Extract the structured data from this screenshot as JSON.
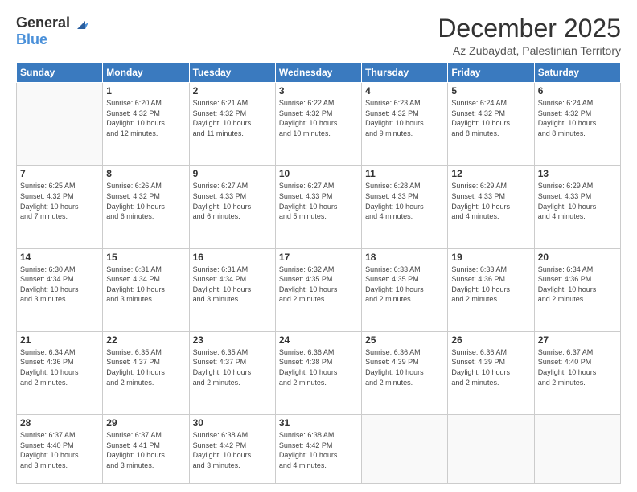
{
  "logo": {
    "general": "General",
    "blue": "Blue"
  },
  "header": {
    "month_year": "December 2025",
    "location": "Az Zubaydat, Palestinian Territory"
  },
  "weekdays": [
    "Sunday",
    "Monday",
    "Tuesday",
    "Wednesday",
    "Thursday",
    "Friday",
    "Saturday"
  ],
  "weeks": [
    [
      {
        "day": "",
        "info": ""
      },
      {
        "day": "1",
        "info": "Sunrise: 6:20 AM\nSunset: 4:32 PM\nDaylight: 10 hours\nand 12 minutes."
      },
      {
        "day": "2",
        "info": "Sunrise: 6:21 AM\nSunset: 4:32 PM\nDaylight: 10 hours\nand 11 minutes."
      },
      {
        "day": "3",
        "info": "Sunrise: 6:22 AM\nSunset: 4:32 PM\nDaylight: 10 hours\nand 10 minutes."
      },
      {
        "day": "4",
        "info": "Sunrise: 6:23 AM\nSunset: 4:32 PM\nDaylight: 10 hours\nand 9 minutes."
      },
      {
        "day": "5",
        "info": "Sunrise: 6:24 AM\nSunset: 4:32 PM\nDaylight: 10 hours\nand 8 minutes."
      },
      {
        "day": "6",
        "info": "Sunrise: 6:24 AM\nSunset: 4:32 PM\nDaylight: 10 hours\nand 8 minutes."
      }
    ],
    [
      {
        "day": "7",
        "info": "Sunrise: 6:25 AM\nSunset: 4:32 PM\nDaylight: 10 hours\nand 7 minutes."
      },
      {
        "day": "8",
        "info": "Sunrise: 6:26 AM\nSunset: 4:32 PM\nDaylight: 10 hours\nand 6 minutes."
      },
      {
        "day": "9",
        "info": "Sunrise: 6:27 AM\nSunset: 4:33 PM\nDaylight: 10 hours\nand 6 minutes."
      },
      {
        "day": "10",
        "info": "Sunrise: 6:27 AM\nSunset: 4:33 PM\nDaylight: 10 hours\nand 5 minutes."
      },
      {
        "day": "11",
        "info": "Sunrise: 6:28 AM\nSunset: 4:33 PM\nDaylight: 10 hours\nand 4 minutes."
      },
      {
        "day": "12",
        "info": "Sunrise: 6:29 AM\nSunset: 4:33 PM\nDaylight: 10 hours\nand 4 minutes."
      },
      {
        "day": "13",
        "info": "Sunrise: 6:29 AM\nSunset: 4:33 PM\nDaylight: 10 hours\nand 4 minutes."
      }
    ],
    [
      {
        "day": "14",
        "info": "Sunrise: 6:30 AM\nSunset: 4:34 PM\nDaylight: 10 hours\nand 3 minutes."
      },
      {
        "day": "15",
        "info": "Sunrise: 6:31 AM\nSunset: 4:34 PM\nDaylight: 10 hours\nand 3 minutes."
      },
      {
        "day": "16",
        "info": "Sunrise: 6:31 AM\nSunset: 4:34 PM\nDaylight: 10 hours\nand 3 minutes."
      },
      {
        "day": "17",
        "info": "Sunrise: 6:32 AM\nSunset: 4:35 PM\nDaylight: 10 hours\nand 2 minutes."
      },
      {
        "day": "18",
        "info": "Sunrise: 6:33 AM\nSunset: 4:35 PM\nDaylight: 10 hours\nand 2 minutes."
      },
      {
        "day": "19",
        "info": "Sunrise: 6:33 AM\nSunset: 4:36 PM\nDaylight: 10 hours\nand 2 minutes."
      },
      {
        "day": "20",
        "info": "Sunrise: 6:34 AM\nSunset: 4:36 PM\nDaylight: 10 hours\nand 2 minutes."
      }
    ],
    [
      {
        "day": "21",
        "info": "Sunrise: 6:34 AM\nSunset: 4:36 PM\nDaylight: 10 hours\nand 2 minutes."
      },
      {
        "day": "22",
        "info": "Sunrise: 6:35 AM\nSunset: 4:37 PM\nDaylight: 10 hours\nand 2 minutes."
      },
      {
        "day": "23",
        "info": "Sunrise: 6:35 AM\nSunset: 4:37 PM\nDaylight: 10 hours\nand 2 minutes."
      },
      {
        "day": "24",
        "info": "Sunrise: 6:36 AM\nSunset: 4:38 PM\nDaylight: 10 hours\nand 2 minutes."
      },
      {
        "day": "25",
        "info": "Sunrise: 6:36 AM\nSunset: 4:39 PM\nDaylight: 10 hours\nand 2 minutes."
      },
      {
        "day": "26",
        "info": "Sunrise: 6:36 AM\nSunset: 4:39 PM\nDaylight: 10 hours\nand 2 minutes."
      },
      {
        "day": "27",
        "info": "Sunrise: 6:37 AM\nSunset: 4:40 PM\nDaylight: 10 hours\nand 2 minutes."
      }
    ],
    [
      {
        "day": "28",
        "info": "Sunrise: 6:37 AM\nSunset: 4:40 PM\nDaylight: 10 hours\nand 3 minutes."
      },
      {
        "day": "29",
        "info": "Sunrise: 6:37 AM\nSunset: 4:41 PM\nDaylight: 10 hours\nand 3 minutes."
      },
      {
        "day": "30",
        "info": "Sunrise: 6:38 AM\nSunset: 4:42 PM\nDaylight: 10 hours\nand 3 minutes."
      },
      {
        "day": "31",
        "info": "Sunrise: 6:38 AM\nSunset: 4:42 PM\nDaylight: 10 hours\nand 4 minutes."
      },
      {
        "day": "",
        "info": ""
      },
      {
        "day": "",
        "info": ""
      },
      {
        "day": "",
        "info": ""
      }
    ]
  ]
}
